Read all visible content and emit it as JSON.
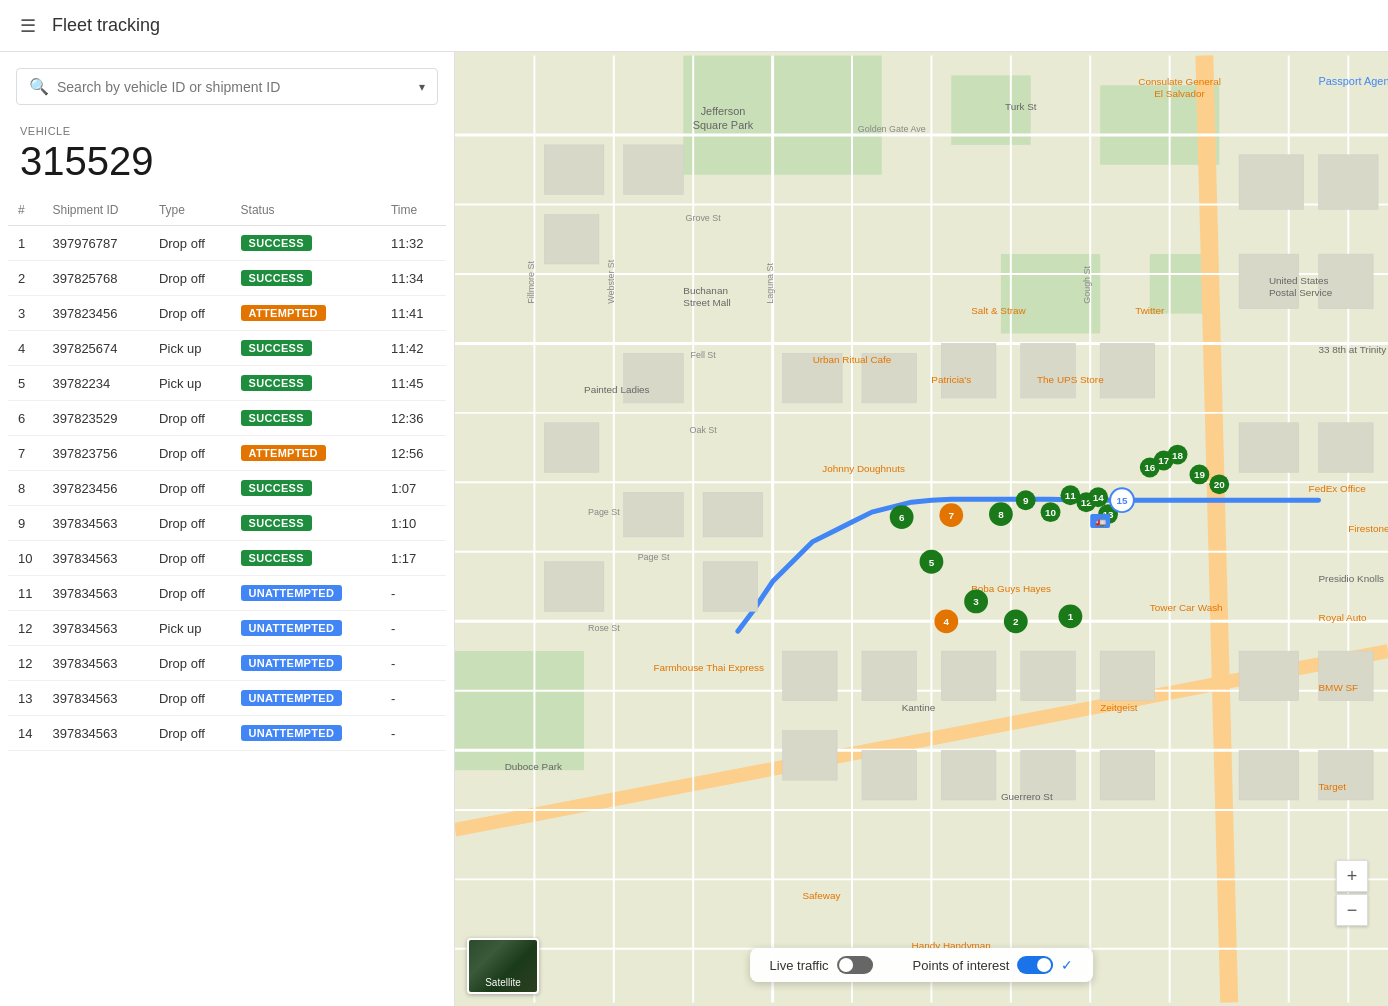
{
  "header": {
    "title": "Fleet tracking",
    "menu_icon": "☰"
  },
  "sidebar": {
    "search": {
      "placeholder": "Search by vehicle ID or shipment ID",
      "value": ""
    },
    "vehicle": {
      "label": "VEHICLE",
      "id": "315529"
    },
    "table": {
      "columns": [
        "#",
        "Shipment ID",
        "Type",
        "Status",
        "Time"
      ],
      "rows": [
        {
          "num": 1,
          "shipment_id": "397976787",
          "type": "Drop off",
          "status": "SUCCESS",
          "status_class": "status-success",
          "time": "11:32"
        },
        {
          "num": 2,
          "shipment_id": "397825768",
          "type": "Drop off",
          "status": "SUCCESS",
          "status_class": "status-success",
          "time": "11:34"
        },
        {
          "num": 3,
          "shipment_id": "397823456",
          "type": "Drop off",
          "status": "ATTEMPTED",
          "status_class": "status-attempted",
          "time": "11:41"
        },
        {
          "num": 4,
          "shipment_id": "397825674",
          "type": "Pick up",
          "status": "SUCCESS",
          "status_class": "status-success",
          "time": "11:42"
        },
        {
          "num": 5,
          "shipment_id": "39782234",
          "type": "Pick up",
          "status": "SUCCESS",
          "status_class": "status-success",
          "time": "11:45"
        },
        {
          "num": 6,
          "shipment_id": "397823529",
          "type": "Drop off",
          "status": "SUCCESS",
          "status_class": "status-success",
          "time": "12:36"
        },
        {
          "num": 7,
          "shipment_id": "397823756",
          "type": "Drop off",
          "status": "ATTEMPTED",
          "status_class": "status-attempted",
          "time": "12:56"
        },
        {
          "num": 8,
          "shipment_id": "397823456",
          "type": "Drop off",
          "status": "SUCCESS",
          "status_class": "status-success",
          "time": "1:07"
        },
        {
          "num": 9,
          "shipment_id": "397834563",
          "type": "Drop off",
          "status": "SUCCESS",
          "status_class": "status-success",
          "time": "1:10"
        },
        {
          "num": 10,
          "shipment_id": "397834563",
          "type": "Drop off",
          "status": "SUCCESS",
          "status_class": "status-success",
          "time": "1:17"
        },
        {
          "num": 11,
          "shipment_id": "397834563",
          "type": "Drop off",
          "status": "UNATTEMPTED",
          "status_class": "status-unattempted",
          "time": "-"
        },
        {
          "num": 12,
          "shipment_id": "397834563",
          "type": "Pick up",
          "status": "UNATTEMPTED",
          "status_class": "status-unattempted",
          "time": "-"
        },
        {
          "num": 12,
          "shipment_id": "397834563",
          "type": "Drop off",
          "status": "UNATTEMPTED",
          "status_class": "status-unattempted",
          "time": "-"
        },
        {
          "num": 13,
          "shipment_id": "397834563",
          "type": "Drop off",
          "status": "UNATTEMPTED",
          "status_class": "status-unattempted",
          "time": "-"
        },
        {
          "num": 14,
          "shipment_id": "397834563",
          "type": "Drop off",
          "status": "UNATTEMPTED",
          "status_class": "status-unattempted",
          "time": "-"
        }
      ]
    }
  },
  "map": {
    "live_traffic_label": "Live traffic",
    "points_of_interest_label": "Points of interest",
    "live_traffic_on": false,
    "points_of_interest_on": true,
    "satellite_label": "Satellite",
    "zoom_in": "+",
    "zoom_out": "−"
  }
}
